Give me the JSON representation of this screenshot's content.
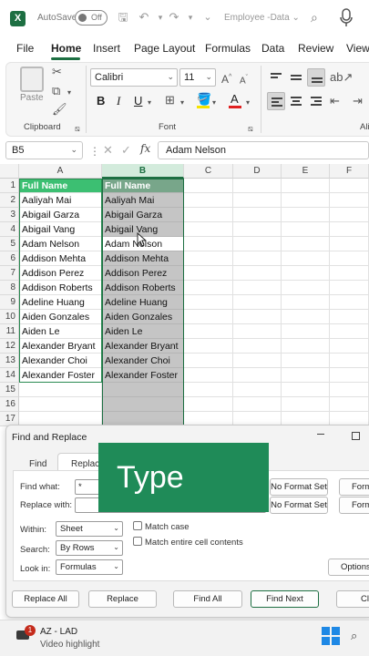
{
  "titlebar": {
    "logo": "X",
    "autosave_label": "AutoSave",
    "toggle_label": "Off",
    "doc_title": "Employee -Data",
    "doc_title_chevron": "⌄"
  },
  "tabs": [
    "File",
    "Home",
    "Insert",
    "Page Layout",
    "Formulas",
    "Data",
    "Review",
    "View"
  ],
  "ribbon": {
    "paste_label": "Paste",
    "clipboard_label": "Clipboard",
    "font_label": "Font",
    "alignment_label": "Ali",
    "font_name": "Calibri",
    "font_size": "11",
    "bold": "B",
    "italic": "I",
    "underline": "U",
    "font_color_letter": "A",
    "grow_letter": "A",
    "shrink_letter": "A"
  },
  "formula_bar": {
    "name_box": "B5",
    "fx": "fx",
    "content": "Adam Nelson"
  },
  "grid": {
    "columns": [
      "A",
      "B",
      "C",
      "D",
      "E",
      "F"
    ],
    "rows": [
      "1",
      "2",
      "3",
      "4",
      "5",
      "6",
      "7",
      "8",
      "9",
      "10",
      "11",
      "12",
      "13",
      "14",
      "15",
      "16",
      "17"
    ],
    "col_a": [
      "Full Name",
      "Aaliyah Mai",
      "Abigail Garza",
      "Abigail Vang",
      "Adam Nelson",
      "Addison Mehta",
      "Addison Perez",
      "Addison Roberts",
      "Adeline Huang",
      "Aiden Gonzales",
      "Aiden Le",
      "Alexander Bryant",
      "Alexander Choi",
      "Alexander Foster"
    ],
    "col_b": [
      "Full Name",
      "Aaliyah Mai",
      "Abigail Garza",
      "Abigail Vang",
      "Adam Nelson",
      "Addison Mehta",
      "Addison Perez",
      "Addison Roberts",
      "Adeline Huang",
      "Aiden Gonzales",
      "Aiden Le",
      "Alexander Bryant",
      "Alexander Choi",
      "Alexander Foster"
    ]
  },
  "dialog": {
    "title": "Find and Replace",
    "tabs": [
      "Find",
      "Replace"
    ],
    "find_label": "Find what:",
    "find_value": "*",
    "replace_label": "Replace with:",
    "replace_value": "",
    "no_format_1": "No Format Set",
    "no_format_2": "No Format Set",
    "format_1": "Format...",
    "format_2": "Format...",
    "within_label": "Within:",
    "within_value": "Sheet",
    "search_label": "Search:",
    "search_value": "By Rows",
    "lookin_label": "Look in:",
    "lookin_value": "Formulas",
    "match_case": "Match case",
    "match_entire": "Match entire cell contents",
    "options": "Options <<",
    "replace_all": "Replace All",
    "replace": "Replace",
    "find_all": "Find All",
    "find_next": "Find Next",
    "close": "Close"
  },
  "overlay": {
    "text": "Type"
  },
  "taskbar": {
    "badge": "1",
    "title": "AZ - LAD",
    "subtitle": "Video highlight"
  },
  "colors": {
    "excel_green": "#1d6f42",
    "header_green": "#3cbf72",
    "overlay_green": "#1f8b58",
    "selection_gray": "#c5c5c5"
  }
}
